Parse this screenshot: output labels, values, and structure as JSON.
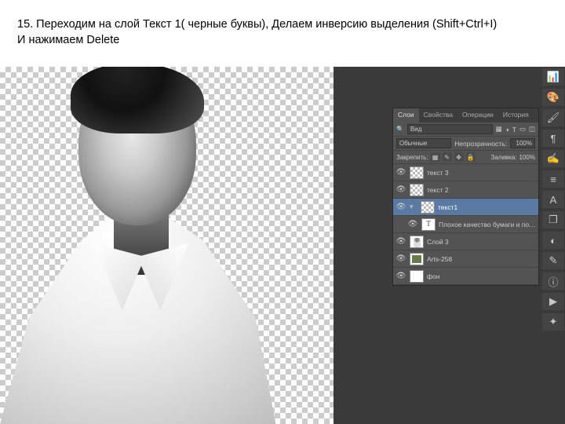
{
  "header": {
    "line1": "15. Переходим на слой Текст 1( черные буквы), Делаем инверсию выделения (Shift+Ctrl+I)",
    "line2": "И нажимаем Delete"
  },
  "tabs": {
    "layers": "Слои",
    "props": "Свойства",
    "ops": "Операции",
    "history": "История"
  },
  "controls": {
    "kind_label": "Вид",
    "blend": "Обычные",
    "opacity_label": "Непрозрачность:",
    "opacity_value": "100%",
    "lock_label": "Закрепить:",
    "fill_label": "Заливка:",
    "fill_value": "100%"
  },
  "layers": [
    {
      "name": "текст 3",
      "thumb": "checker",
      "eye": true
    },
    {
      "name": "текст 2",
      "thumb": "checker",
      "eye": true
    },
    {
      "name": "текст1",
      "thumb": "checker",
      "eye": true,
      "selected": true,
      "group": true
    },
    {
      "name": "Плохое качество бумаги и полиграфии предъя...",
      "thumb": "txt",
      "eye": true,
      "indent": true
    },
    {
      "name": "Слой 3",
      "thumb": "person",
      "eye": true
    },
    {
      "name": "Arts-258",
      "thumb": "green",
      "eye": true
    },
    {
      "name": "фон",
      "thumb": "white",
      "eye": true
    }
  ],
  "tool_icons": [
    "histogram",
    "swatch",
    "brush",
    "text",
    "clone",
    "paragraph",
    "a-icon",
    "gradient",
    "gear",
    "notes",
    "ruler",
    "shapes",
    "anchor"
  ]
}
